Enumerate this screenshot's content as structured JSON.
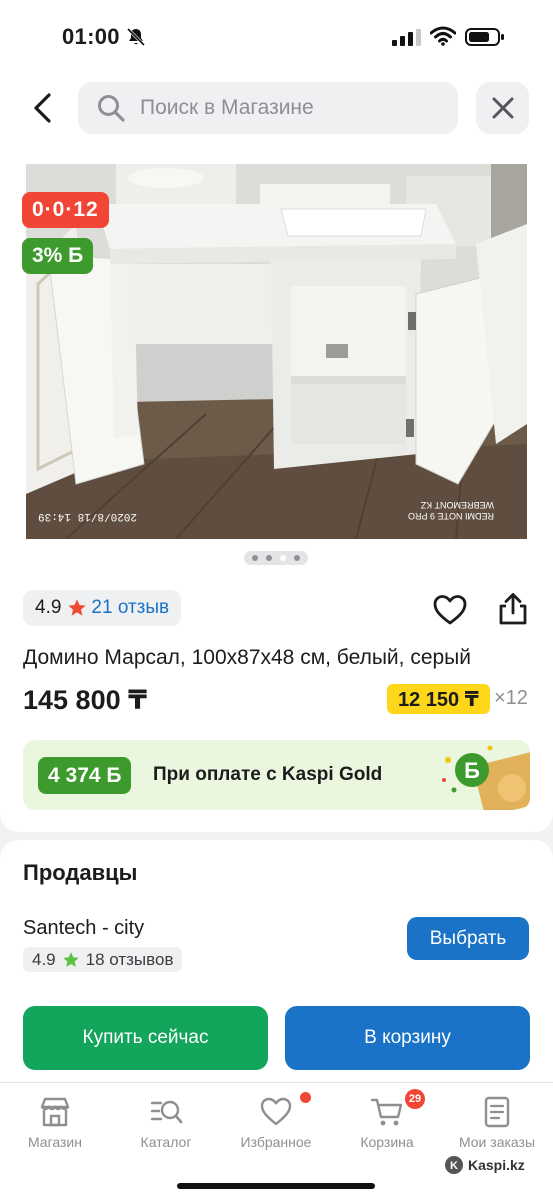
{
  "status_bar": {
    "time": "01:00"
  },
  "search": {
    "placeholder": "Поиск в Магазине"
  },
  "product": {
    "badges": {
      "timer": "0·0·12",
      "bonus": "3% Б"
    },
    "image_photo_stamp": "2020/8/18 14:39",
    "image_camera_stamp": "REDMI NOTE 9 PRO\nWEBREMONT KZ",
    "pager": {
      "count": 4,
      "active_index": 2
    },
    "rating": {
      "score": "4.9",
      "reviews": "21 отзыв"
    },
    "title": "Домино Марсал, 100х87х48 см, белый, серый",
    "price": "145 800 ₸",
    "installment": {
      "amount": "12 150 ₸",
      "term": "×12"
    },
    "gold": {
      "bonus": "4 374 Б",
      "text": "При оплате с Kaspi Gold"
    }
  },
  "sellers": {
    "heading": "Продавцы",
    "seller": {
      "name": "Santech - city",
      "rating": "4.9",
      "reviews": "18 отзывов"
    },
    "select_label": "Выбрать",
    "buy_now_label": "Купить сейчас",
    "to_cart_label": "В корзину"
  },
  "tab_bar": {
    "tabs": [
      {
        "label": "Магазин",
        "icon": "store-icon"
      },
      {
        "label": "Каталог",
        "icon": "catalog-search-icon"
      },
      {
        "label": "Избранное",
        "icon": "heart-icon"
      },
      {
        "label": "Корзина",
        "icon": "cart-icon",
        "badge": "29"
      },
      {
        "label": "Мои заказы",
        "icon": "orders-icon"
      }
    ]
  },
  "watermark": "Kaspi.kz",
  "colors": {
    "accent_blue": "#1a73c7",
    "buy_green": "#13a55c",
    "bonus_green": "#3d9a2c",
    "timer_red": "#f14635",
    "installment_yellow": "#ffd71a"
  }
}
